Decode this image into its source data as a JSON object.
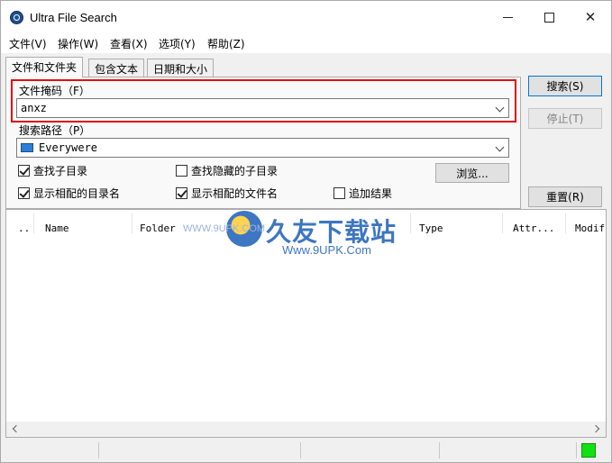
{
  "window": {
    "title": "Ultra File Search"
  },
  "menu": [
    "文件(V)",
    "操作(W)",
    "查看(X)",
    "选项(Y)",
    "帮助(Z)"
  ],
  "tabs": [
    "文件和文件夹",
    "包含文本",
    "日期和大小"
  ],
  "form": {
    "mask_label": "文件掩码（F）",
    "mask_value": "anxz",
    "path_label": "搜索路径（P）",
    "path_value": "Everywere",
    "chk_subdirs": "查找子目录",
    "chk_hidden_subdirs": "查找隐藏的子目录",
    "chk_show_dir_names": "显示相配的目录名",
    "chk_show_file_names": "显示相配的文件名",
    "chk_append_results": "追加结果",
    "browse_label": "浏览..."
  },
  "buttons": {
    "search": "搜索(S)",
    "stop": "停止(T)",
    "reset": "重置(R)"
  },
  "columns": [
    "..",
    "Name",
    "Folder",
    "Type",
    "Attr...",
    "Modif"
  ],
  "watermark": {
    "brand": "久友下载站",
    "url": "Www.9UPK.Com",
    "url_small": "WWW.9UPK.COM"
  },
  "colors": {
    "highlight": "#e01010",
    "status_indicator": "#12e012"
  }
}
